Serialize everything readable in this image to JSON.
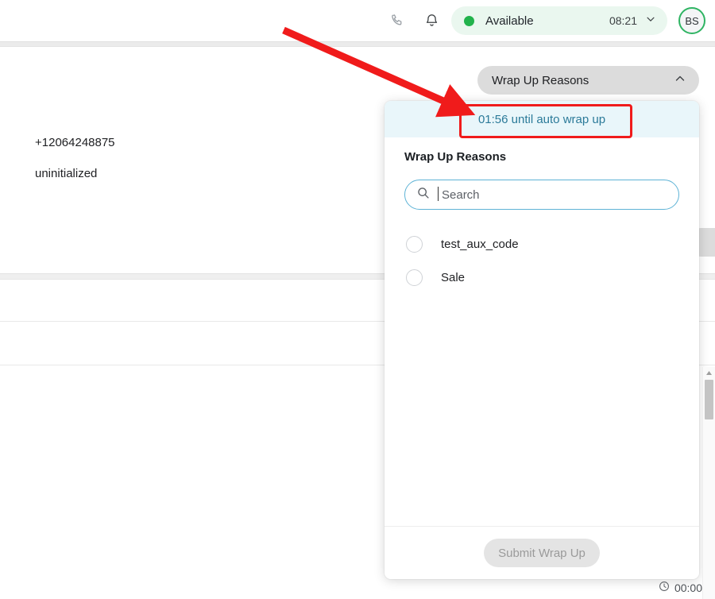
{
  "topbar": {
    "phone_icon": "phone-icon",
    "bell_icon": "bell-icon",
    "status_label": "Available",
    "status_time": "08:21",
    "status_chevron_icon": "chevron-down-icon",
    "status_dot_color": "#22b24c",
    "status_pill_bg": "#eaf7ef",
    "avatar_initials": "BS",
    "avatar_ring_color": "#2fb463"
  },
  "page": {
    "call_number": "+12064248875",
    "call_state": "uninitialized"
  },
  "wrapup_trigger": {
    "label": "Wrap Up Reasons",
    "chevron_icon": "chevron-up-icon",
    "bg_color": "#dcdcdc"
  },
  "popup": {
    "banner_text": "01:56 until auto wrap up",
    "banner_bg": "#e9f6fa",
    "banner_text_color": "#2b7a99",
    "title": "Wrap Up Reasons",
    "search": {
      "icon": "search-icon",
      "placeholder": "Search",
      "value": "",
      "border_color": "#5eb3d6"
    },
    "options": [
      {
        "label": "test_aux_code",
        "selected": false
      },
      {
        "label": "Sale",
        "selected": false
      }
    ],
    "submit_label": "Submit Wrap Up",
    "submit_disabled": true
  },
  "bottom": {
    "clock_icon": "clock-icon",
    "timer": "00:00"
  },
  "scrollbar": {
    "up_arrow_icon": "triangle-up-icon"
  },
  "annotation": {
    "arrow_color": "#f01b1b",
    "box_color": "#f01b1b"
  }
}
